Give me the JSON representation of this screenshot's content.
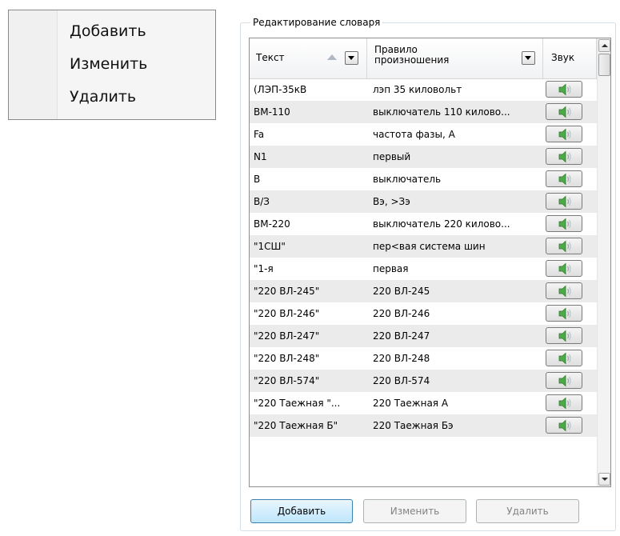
{
  "context_menu": {
    "items": [
      "Добавить",
      "Изменить",
      "Удалить"
    ]
  },
  "group": {
    "title": "Редактирование словаря"
  },
  "grid": {
    "columns": {
      "text": "Текст",
      "rule": "Правило\nпроизношения",
      "sound": "Звук"
    },
    "rows": [
      {
        "text": "(ЛЭП-35кВ",
        "rule": "лэп 35 киловольт"
      },
      {
        "text": "ВМ-110",
        "rule": "выключатель 110 килово..."
      },
      {
        "text": "Fa",
        "rule": "частота фазы, А"
      },
      {
        "text": "N1",
        "rule": "первый"
      },
      {
        "text": "В",
        "rule": "выключатель"
      },
      {
        "text": "В/З",
        "rule": "Вэ, >Зэ"
      },
      {
        "text": "ВМ-220",
        "rule": "выключатель 220 килово..."
      },
      {
        "text": "\"1СШ\"",
        "rule": "пер<вая система шин"
      },
      {
        "text": "\"1-я",
        "rule": "первая"
      },
      {
        "text": "\"220 ВЛ-245\"",
        "rule": "220 ВЛ-245"
      },
      {
        "text": "\"220 ВЛ-246\"",
        "rule": "220 ВЛ-246"
      },
      {
        "text": "\"220 ВЛ-247\"",
        "rule": "220 ВЛ-247"
      },
      {
        "text": "\"220 ВЛ-248\"",
        "rule": "220 ВЛ-248"
      },
      {
        "text": "\"220 ВЛ-574\"",
        "rule": "220 ВЛ-574"
      },
      {
        "text": "\"220 Таежная \"...",
        "rule": "220 Таежная А"
      },
      {
        "text": "\"220 Таежная Б\"",
        "rule": "220 Таежная Бэ"
      }
    ]
  },
  "buttons": {
    "add": "Добавить",
    "edit": "Изменить",
    "delete": "Удалить"
  },
  "icons": {
    "sound": "speaker-icon",
    "sort": "sort-ascending-icon",
    "filter": "dropdown-filter-icon"
  },
  "colors": {
    "alt_row": "#ebebeb",
    "speaker": "#4fa84a",
    "primary_button": "#bee6fd"
  }
}
